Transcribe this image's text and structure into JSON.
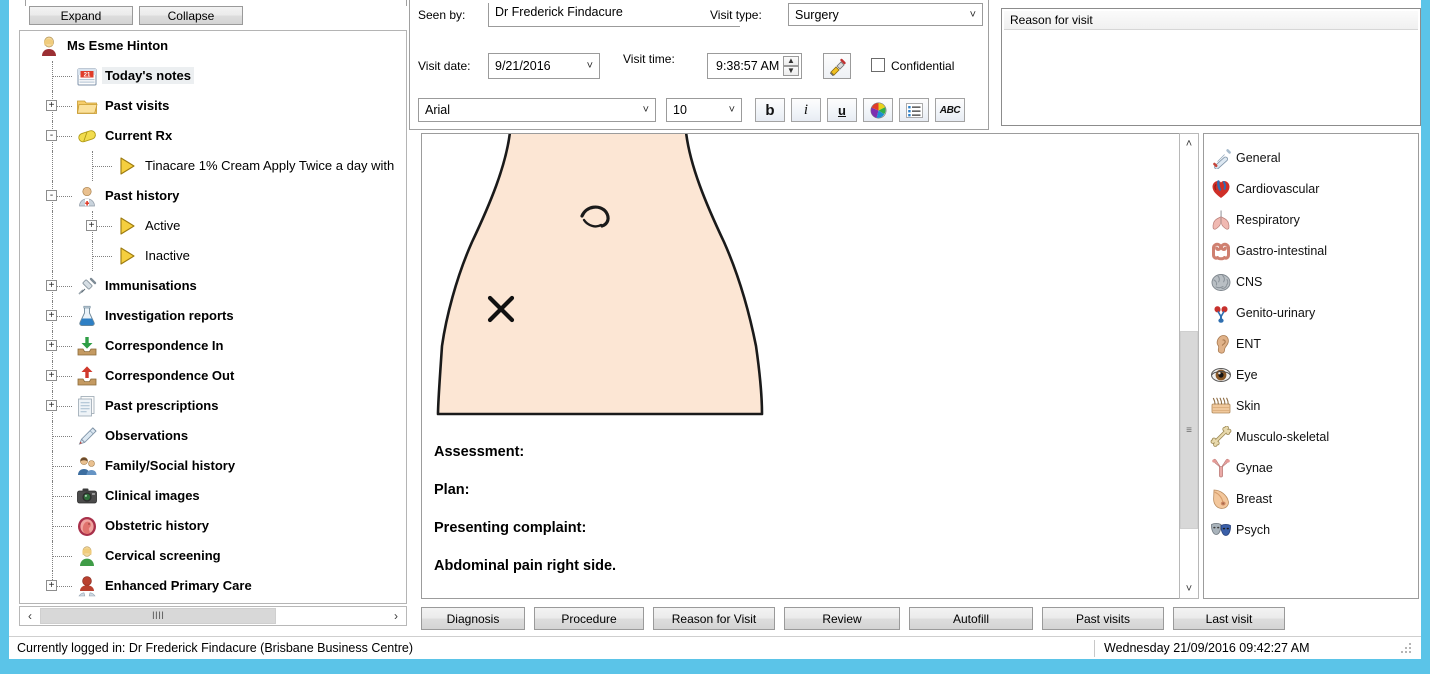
{
  "window": {
    "accent_color": "#5bc4e8",
    "background": "#ffffff"
  },
  "left_panel": {
    "expand_label": "Expand",
    "collapse_label": "Collapse",
    "tree": [
      {
        "label": "Ms Esme Hinton",
        "icon": "patient-icon",
        "indent": 0,
        "expander": "-",
        "bold": true,
        "selected": false
      },
      {
        "label": "Today's notes",
        "icon": "calendar-icon",
        "indent": 1,
        "expander": "",
        "bold": true,
        "selected": true
      },
      {
        "label": "Past visits",
        "icon": "folder-icon",
        "indent": 1,
        "expander": "+",
        "bold": true,
        "selected": false
      },
      {
        "label": "Current Rx",
        "icon": "pill-icon",
        "indent": 1,
        "expander": "-",
        "bold": true,
        "selected": false
      },
      {
        "label": "Tinacare 1% Cream Apply Twice a day with",
        "icon": "arrow-icon",
        "indent": 2,
        "expander": "",
        "bold": false,
        "selected": false
      },
      {
        "label": "Past history",
        "icon": "doctor-icon",
        "indent": 1,
        "expander": "-",
        "bold": true,
        "selected": false
      },
      {
        "label": "Active",
        "icon": "arrow-icon",
        "indent": 2,
        "expander": "+",
        "bold": false,
        "selected": false
      },
      {
        "label": "Inactive",
        "icon": "arrow-icon",
        "indent": 2,
        "expander": "",
        "bold": false,
        "selected": false
      },
      {
        "label": "Immunisations",
        "icon": "syringe-icon",
        "indent": 1,
        "expander": "+",
        "bold": true,
        "selected": false
      },
      {
        "label": "Investigation reports",
        "icon": "flask-icon",
        "indent": 1,
        "expander": "+",
        "bold": true,
        "selected": false
      },
      {
        "label": "Correspondence In",
        "icon": "inbox-down-icon",
        "indent": 1,
        "expander": "+",
        "bold": true,
        "selected": false
      },
      {
        "label": "Correspondence Out",
        "icon": "inbox-up-icon",
        "indent": 1,
        "expander": "+",
        "bold": true,
        "selected": false
      },
      {
        "label": "Past prescriptions",
        "icon": "documents-icon",
        "indent": 1,
        "expander": "+",
        "bold": true,
        "selected": false
      },
      {
        "label": "Observations",
        "icon": "pencil-icon",
        "indent": 1,
        "expander": "",
        "bold": true,
        "selected": false
      },
      {
        "label": "Family/Social history",
        "icon": "family-icon",
        "indent": 1,
        "expander": "",
        "bold": true,
        "selected": false
      },
      {
        "label": "Clinical images",
        "icon": "camera-icon",
        "indent": 1,
        "expander": "",
        "bold": true,
        "selected": false
      },
      {
        "label": "Obstetric history",
        "icon": "fetus-icon",
        "indent": 1,
        "expander": "",
        "bold": true,
        "selected": false
      },
      {
        "label": "Cervical screening",
        "icon": "woman-icon",
        "indent": 1,
        "expander": "",
        "bold": true,
        "selected": false
      },
      {
        "label": "Enhanced Primary Care",
        "icon": "care-icon",
        "indent": 1,
        "expander": "+",
        "bold": true,
        "selected": false
      }
    ],
    "hscroll": {
      "left_arrow": "‹",
      "right_arrow": "›",
      "thumb_grip": "IIII"
    }
  },
  "visit_form": {
    "seen_by_label": "Seen by:",
    "seen_by_value": "Dr Frederick Findacure",
    "visit_type_label": "Visit type:",
    "visit_type_value": "Surgery",
    "visit_date_label": "Visit date:",
    "visit_date_value": "9/21/2016",
    "visit_time_label": "Visit time:",
    "visit_time_value": "9:38:57 AM",
    "confidential_label": "Confidential",
    "confidential_checked": false,
    "stamp_icon": "stamp-icon"
  },
  "format_toolbar": {
    "font_family_value": "Arial",
    "font_size_value": "10",
    "bold_label": "b",
    "italic_label": "i",
    "underline_label": "u",
    "color_icon": "color-wheel-icon",
    "list_icon": "bullet-list-icon",
    "spell_label": "ABC"
  },
  "reason_for_visit": {
    "column_header": "Reason for visit",
    "rows": []
  },
  "note": {
    "body_diagram": "abdomen-torso-diagram",
    "marker": "x-mark",
    "lines": [
      "Assessment:",
      "Plan:",
      "Presenting complaint:",
      "Abdominal pain right side."
    ],
    "vscroll": {
      "up_arrow": "˄",
      "down_arrow": "˅",
      "thumb_grip": "≡"
    }
  },
  "systems_panel": {
    "items": [
      {
        "label": "General",
        "icon": "thermometer-icon"
      },
      {
        "label": "Cardiovascular",
        "icon": "heart-icon"
      },
      {
        "label": "Respiratory",
        "icon": "lungs-icon"
      },
      {
        "label": "Gastro-intestinal",
        "icon": "intestine-icon"
      },
      {
        "label": "CNS",
        "icon": "brain-icon"
      },
      {
        "label": "Genito-urinary",
        "icon": "kidney-icon"
      },
      {
        "label": "ENT",
        "icon": "ear-icon"
      },
      {
        "label": "Eye",
        "icon": "eye-icon"
      },
      {
        "label": "Skin",
        "icon": "skin-icon"
      },
      {
        "label": "Musculo-skeletal",
        "icon": "bone-icon"
      },
      {
        "label": "Gynae",
        "icon": "uterus-icon"
      },
      {
        "label": "Breast",
        "icon": "breast-icon"
      },
      {
        "label": "Psych",
        "icon": "masks-icon"
      }
    ]
  },
  "action_buttons": [
    {
      "label": "Diagnosis"
    },
    {
      "label": "Procedure"
    },
    {
      "label": "Reason for Visit"
    },
    {
      "label": "Review"
    },
    {
      "label": "Autofill"
    },
    {
      "label": "Past visits"
    },
    {
      "label": "Last visit"
    }
  ],
  "status_bar": {
    "logged_in": "Currently logged in:  Dr Frederick Findacure (Brisbane Business Centre)",
    "datetime": "Wednesday 21/09/2016 09:42:27 AM"
  }
}
